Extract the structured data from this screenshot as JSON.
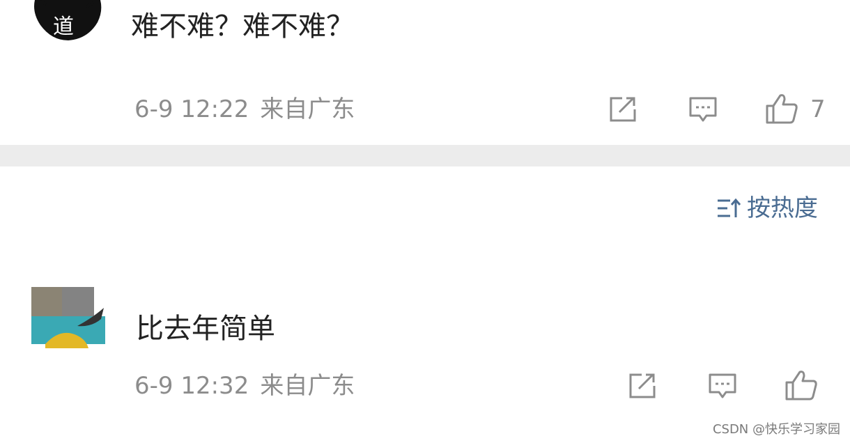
{
  "comments": [
    {
      "avatar_char": "道",
      "text": "难不难？难不难？",
      "time": "6-9 12:22",
      "location": "来自广东",
      "like_count": "7"
    },
    {
      "text": "比去年简单",
      "time": "6-9 12:32",
      "location": "来自广东"
    }
  ],
  "sort": {
    "label": "按热度"
  },
  "icons": {
    "share": "share-icon",
    "comment": "comment-icon",
    "like": "thumbs-up-icon",
    "sort": "sort-icon"
  },
  "colors": {
    "meta_text": "#8c8c8c",
    "sort_accent": "#4a6c92",
    "divider": "#ececec"
  },
  "watermark": "CSDN @快乐学习家园"
}
